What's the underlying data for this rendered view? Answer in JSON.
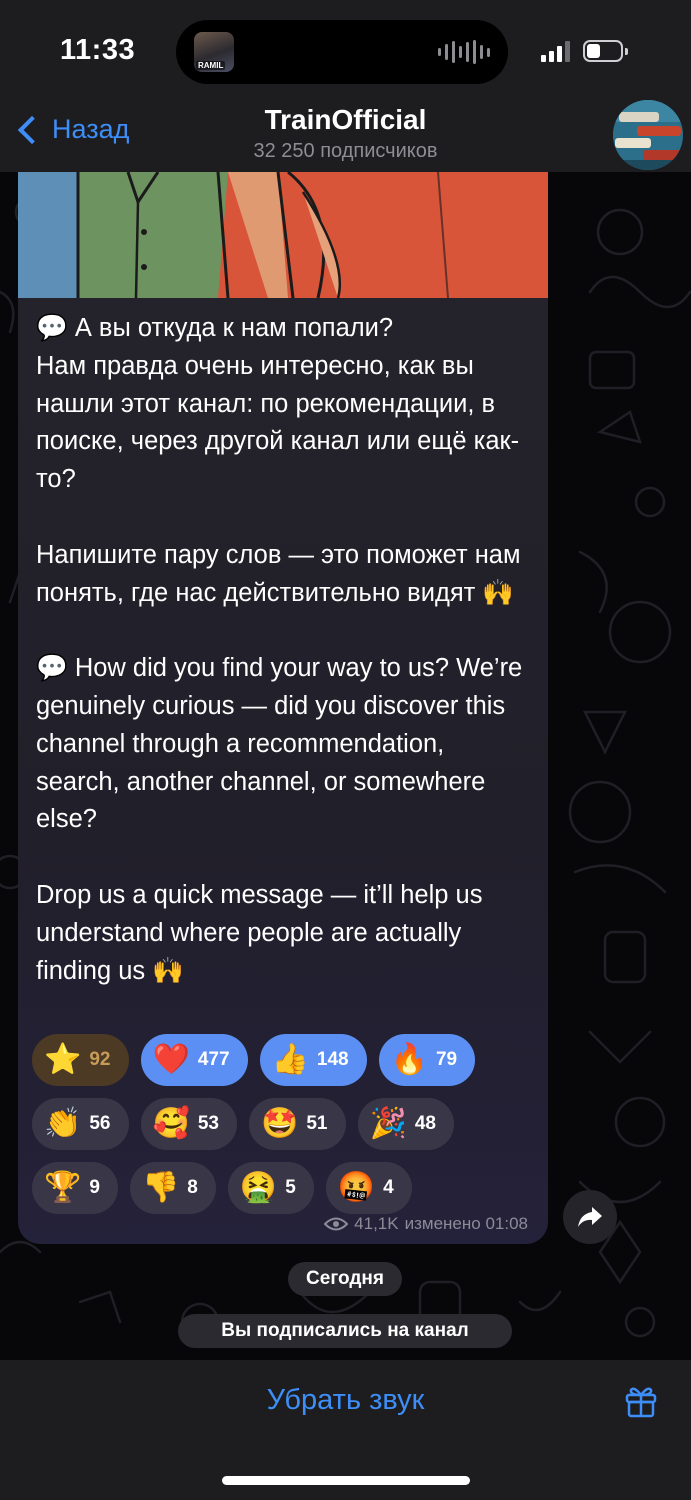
{
  "status_bar": {
    "time": "11:33",
    "island_thumb_label": "RAMIL"
  },
  "nav": {
    "back_label": "Назад",
    "title": "TrainOfficial",
    "subtitle": "32 250 подписчиков"
  },
  "message": {
    "text": "💬 А вы откуда к нам попали?\nНам правда очень интересно, как вы нашли этот канал: по рекомендации, в поиске, через другой канал или ещё как-то?\n\nНапишите пару слов — это поможет нам понять, где нас действительно видят 🙌\n\n💬 How did you find your way to us? We’re genuinely curious — did you discover this channel through a recommendation, search, another channel, or somewhere else?\n\nDrop us a quick message — it’ll help us understand where people are actually finding us 🙌",
    "reactions": [
      {
        "emoji": "⭐",
        "count": "92",
        "style": "gold"
      },
      {
        "emoji": "❤️",
        "count": "477",
        "style": "chosen"
      },
      {
        "emoji": "👍",
        "count": "148",
        "style": "chosen"
      },
      {
        "emoji": "🔥",
        "count": "79",
        "style": "chosen"
      },
      {
        "emoji": "👏",
        "count": "56",
        "style": "normal"
      },
      {
        "emoji": "🥰",
        "count": "53",
        "style": "normal"
      },
      {
        "emoji": "🤩",
        "count": "51",
        "style": "normal"
      },
      {
        "emoji": "🎉",
        "count": "48",
        "style": "normal"
      },
      {
        "emoji": "🏆",
        "count": "9",
        "style": "normal"
      },
      {
        "emoji": "👎",
        "count": "8",
        "style": "normal"
      },
      {
        "emoji": "🤮",
        "count": "5",
        "style": "normal"
      },
      {
        "emoji": "🤬",
        "count": "4",
        "style": "normal"
      }
    ],
    "views": "41,1K",
    "edited_label": "изменено 01:08"
  },
  "date_separator": "Сегодня",
  "service_message": "Вы подписались на канал",
  "bottom_bar": {
    "mute_label": "Убрать звук"
  },
  "colors": {
    "accent": "#3e8ef7",
    "chosen_reaction": "#5c8ff3",
    "bubble": "#25242c",
    "header": "#1d1d20"
  }
}
